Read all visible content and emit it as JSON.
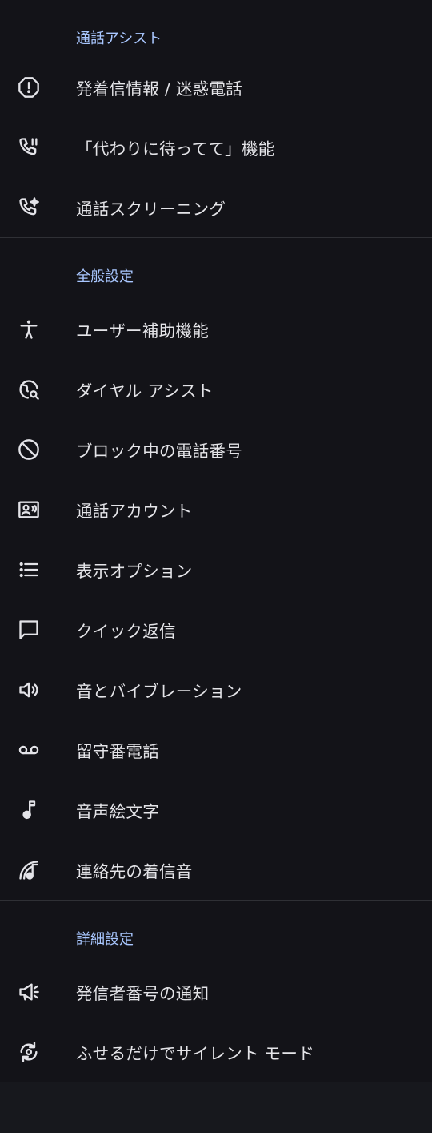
{
  "colors": {
    "background": "#131318",
    "accent": "#a9c7ff",
    "text": "#e3e3e8",
    "divider": "#2f3035"
  },
  "sections": [
    {
      "header": "通話アシスト",
      "items": [
        {
          "icon": "alert-icon",
          "label": "発着信情報 / 迷惑電話"
        },
        {
          "icon": "phone-hold-icon",
          "label": "「代わりに待ってて」機能"
        },
        {
          "icon": "phone-sparkle-icon",
          "label": "通話スクリーニング"
        }
      ]
    },
    {
      "header": "全般設定",
      "items": [
        {
          "icon": "accessibility-icon",
          "label": "ユーザー補助機能"
        },
        {
          "icon": "globe-search-icon",
          "label": "ダイヤル アシスト"
        },
        {
          "icon": "block-icon",
          "label": "ブロック中の電話番号"
        },
        {
          "icon": "contact-card-icon",
          "label": "通話アカウント"
        },
        {
          "icon": "list-icon",
          "label": "表示オプション"
        },
        {
          "icon": "message-icon",
          "label": "クイック返信"
        },
        {
          "icon": "volume-icon",
          "label": "音とバイブレーション"
        },
        {
          "icon": "voicemail-icon",
          "label": "留守番電話"
        },
        {
          "icon": "music-note-icon",
          "label": "音声絵文字"
        },
        {
          "icon": "ringtone-icon",
          "label": "連絡先の着信音"
        }
      ]
    },
    {
      "header": "詳細設定",
      "items": [
        {
          "icon": "megaphone-icon",
          "label": "発信者番号の通知"
        },
        {
          "icon": "flip-icon",
          "label": "ふせるだけでサイレント モード"
        }
      ]
    }
  ]
}
